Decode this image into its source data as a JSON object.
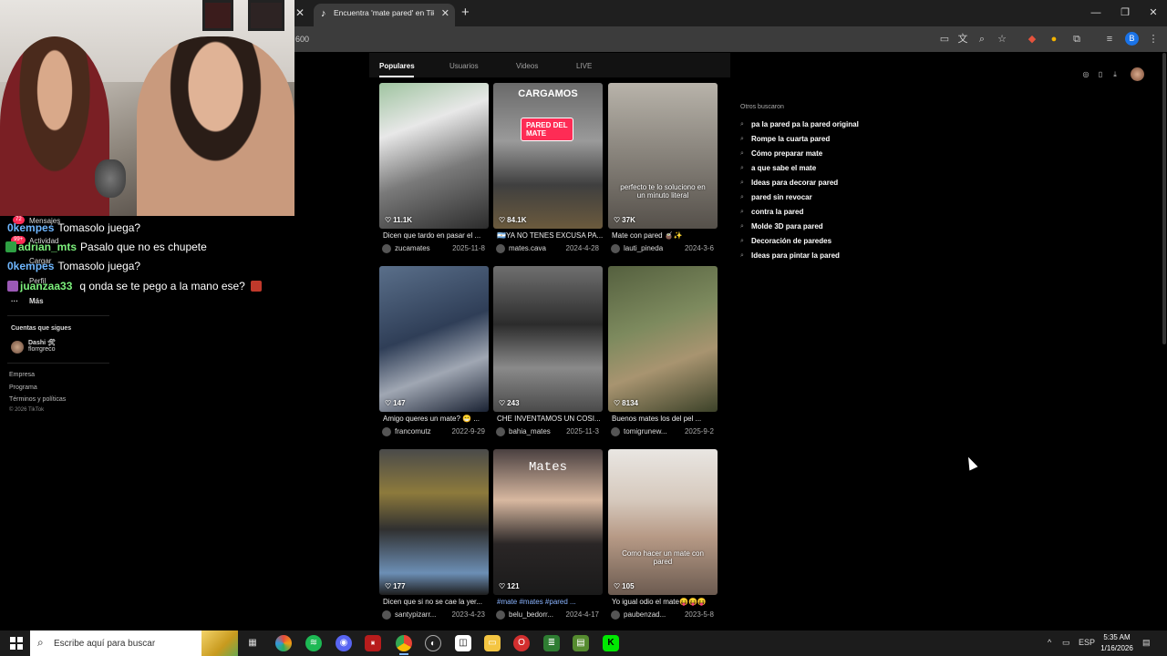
{
  "browser": {
    "tab_title": "Encuentra 'mate pared' en TikTok",
    "address_fragment": "600",
    "profile_letter": "B",
    "tab_close_glyph": "✕",
    "new_tab_glyph": "+",
    "window_minimize": "—",
    "window_restore": "❐",
    "window_close": "✕"
  },
  "chat": [
    {
      "user": "0kempes",
      "message": "Tomasolo juega?",
      "color": "#6fb7ff"
    },
    {
      "user": "adrian_mts",
      "message": "Pasalo que no es chupete",
      "color": "#7cf07c"
    },
    {
      "user": "0kempes",
      "message": "Tomasolo juega?",
      "color": "#6fb7ff"
    },
    {
      "user": "juanzaa33",
      "message": "q onda se te pego a la mano ese?",
      "color": "#7cf07c"
    }
  ],
  "tiktok_nav": {
    "mensajes": "Mensajes",
    "mensajes_badge": "72",
    "actividad": "Actividad",
    "actividad_badge": "99+",
    "cargar": "Cargar",
    "perfil": "Perfil",
    "mas": "Más",
    "following_title": "Cuentas que sigues",
    "following_name": "Dashi 🛠",
    "following_handle": "florrgreco",
    "footer": [
      "Empresa",
      "Programa",
      "Términos y políticas",
      "© 2026 TikTok"
    ]
  },
  "results_tabs": [
    "Populares",
    "Usuarios",
    "Videos",
    "LIVE"
  ],
  "videos": [
    {
      "likes": "11.1K",
      "caption": "Dicen que tardo en pasar el ...",
      "author": "zucamates",
      "date": "2025-11-8",
      "bg": "linear-gradient(160deg,#9fc4a0 0%,#e8e8e8 30%,#7a7a7a 60%,#2c2c2c 100%)"
    },
    {
      "likes": "84.1K",
      "caption": "🇦🇷YA NO TENES EXCUSA PA...",
      "author": "mates.cava",
      "date": "2024-4-28",
      "bg": "linear-gradient(180deg,#6a6a6a 0%,#9a9a9a 40%,#3f3f3f 70%,#6b5a3d 100%)",
      "overlay": "CARGAMOS",
      "badge": "PARED DEL MATE"
    },
    {
      "likes": "37K",
      "caption": "Mate con pared 🧉✨",
      "author": "lauti_pineda",
      "date": "2024-3-6",
      "bg": "linear-gradient(180deg,#b8b3aa 0%,#8c877f 45%,#55504a 100%)",
      "subtitle": "perfecto te lo soluciono en un minuto literal"
    },
    {
      "likes": "147",
      "caption": "Amigo queres un mate? 😁 ...",
      "author": "francomutz",
      "date": "2022-9-29",
      "bg": "linear-gradient(160deg,#5a6f8a 0%,#2f3e57 45%,#a0a7b3 70%,#1a2233 100%)"
    },
    {
      "likes": "243",
      "caption": "CHE INVENTAMOS UN COSI...",
      "author": "bahia_mates",
      "date": "2025-11-3",
      "bg": "linear-gradient(180deg,#6f6f6f 0%,#2c2c2c 40%,#8a8a8a 70%,#4a4a4a 100%)"
    },
    {
      "likes": "8134",
      "caption": "Buenos mates los del pel ...",
      "author": "tomigrunew...",
      "date": "2025-9-2",
      "bg": "linear-gradient(160deg,#55603f 0%,#7d8a5e 40%,#a89470 65%,#3c4229 100%)"
    },
    {
      "likes": "177",
      "caption": "Dicen que si no se cae la yer...",
      "author": "santypizarr...",
      "date": "2023-4-23",
      "bg": "linear-gradient(180deg,#4a4a4a 0%,#8d7a3c 30%,#303030 55%,#6c8fb5 85%,#1d1d1d 100%)"
    },
    {
      "likes": "121",
      "caption": "#mate #mates #pared ...",
      "author": "belu_bedorr...",
      "date": "2024-4-17",
      "bg": "linear-gradient(180deg,#4a4040 0%,#d8b8a0 35%,#2a2626 65%,#1a1a1a 100%)",
      "overlay_title": "Mates",
      "tag_caption": true
    },
    {
      "likes": "105",
      "caption": "Yo igual odio el mate😝😝😝",
      "author": "paubenzad...",
      "date": "2023-5-8",
      "bg": "linear-gradient(180deg,#e9e6e2 0%,#d6c9bd 35%,#b79a86 60%,#6c5b50 100%)",
      "subtitle": "Como hacer un mate con pared"
    }
  ],
  "others": {
    "title": "Otros buscaron",
    "items": [
      "pa la pared pa la pared original",
      "Rompe la cuarta pared",
      "Cómo preparar mate",
      "a que sabe el mate",
      "Ideas para decorar pared",
      "pared sin revocar",
      "contra la pared",
      "Molde 3D para pared",
      "Decoración de paredes",
      "Ideas para pintar la pared"
    ]
  },
  "taskbar": {
    "search_placeholder": "Escribe aquí para buscar",
    "lang": "ESP",
    "time": "5:35 AM",
    "date": "1/16/2026"
  },
  "colors": {
    "tiktok_red": "#fe2c55",
    "chat_blue": "#6fb7ff",
    "chat_green": "#7cf07c",
    "tag_blue": "#8ab4ff"
  }
}
